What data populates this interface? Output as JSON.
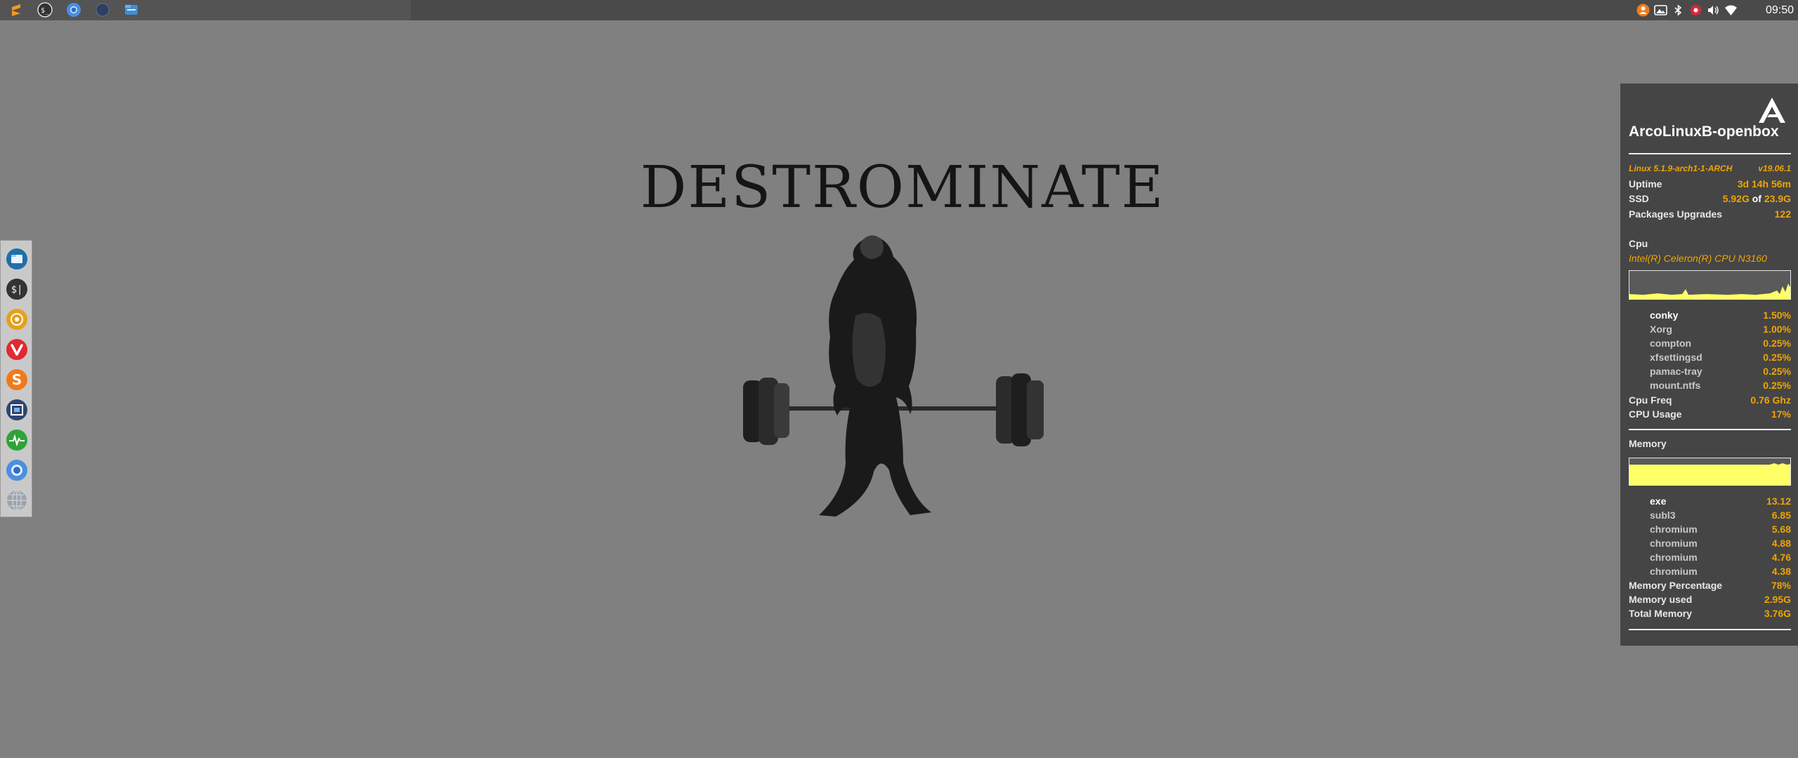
{
  "clock": "09:50",
  "wallpaper": {
    "title": "DESTROMINATE"
  },
  "conky": {
    "hostname": "ArcoLinuxB-openbox",
    "kernel": "Linux 5.1.9-arch1-1-ARCH",
    "version": "v19.06.1",
    "uptime_label": "Uptime",
    "uptime_value": "3d 14h 56m",
    "ssd_label": "SSD",
    "ssd_used": "5.92G",
    "ssd_of": "of",
    "ssd_total": "23.9G",
    "packages_label": "Packages Upgrades",
    "packages_value": "122",
    "cpu_heading": "Cpu",
    "cpu_model": "Intel(R) Celeron(R) CPU  N3160",
    "cpu_processes": [
      {
        "name": "conky",
        "value": "1.50%"
      },
      {
        "name": "Xorg",
        "value": "1.00%"
      },
      {
        "name": "compton",
        "value": "0.25%"
      },
      {
        "name": "xfsettingsd",
        "value": "0.25%"
      },
      {
        "name": "pamac-tray",
        "value": "0.25%"
      },
      {
        "name": "mount.ntfs",
        "value": "0.25%"
      }
    ],
    "cpu_freq_label": "Cpu Freq",
    "cpu_freq_value": "0.76 Ghz",
    "cpu_usage_label": "CPU Usage",
    "cpu_usage_value": "17%",
    "memory_heading": "Memory",
    "memory_processes": [
      {
        "name": "exe",
        "value": "13.12"
      },
      {
        "name": "subl3",
        "value": "6.85"
      },
      {
        "name": "chromium",
        "value": "5.68"
      },
      {
        "name": "chromium",
        "value": "4.88"
      },
      {
        "name": "chromium",
        "value": "4.76"
      },
      {
        "name": "chromium",
        "value": "4.38"
      }
    ],
    "mem_pct_label": "Memory Percentage",
    "mem_pct_value": "78%",
    "mem_used_label": "Memory used",
    "mem_used_value": "2.95G",
    "mem_total_label": "Total Memory",
    "mem_total_value": "3.76G",
    "accent": "#f0a400",
    "graph_color": "#ffff66"
  },
  "launchers": [
    "sublime-text-icon",
    "terminal-icon",
    "chromium-icon",
    "blank-app-icon",
    "file-manager-icon"
  ],
  "dock": [
    "file-manager-icon",
    "terminal-icon",
    "rhythmbox-icon",
    "vivaldi-icon",
    "sublime-icon",
    "screenshot-icon",
    "system-monitor-icon",
    "chromium-icon",
    "network-icon"
  ],
  "tray": [
    "user-icon",
    "image-icon",
    "bluetooth-icon",
    "update-icon",
    "volume-icon",
    "wifi-icon"
  ]
}
